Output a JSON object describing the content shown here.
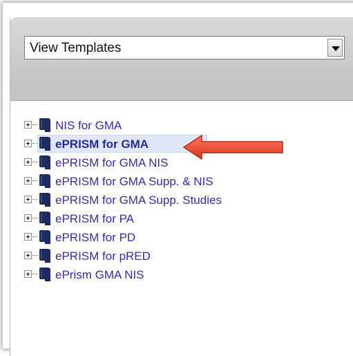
{
  "templates_select": {
    "value": "View Templates"
  },
  "tree": {
    "items": [
      {
        "label": "NIS for GMA"
      },
      {
        "label": "ePRISM for GMA"
      },
      {
        "label": "ePRISM for GMA NIS"
      },
      {
        "label": "ePRISM for GMA Supp. & NIS"
      },
      {
        "label": "ePRISM for GMA Supp. Studies"
      },
      {
        "label": "ePRISM for PA"
      },
      {
        "label": "ePRISM for PD"
      },
      {
        "label": "ePRISM for pRED"
      },
      {
        "label": "ePrism GMA NIS"
      }
    ],
    "selected_index": 1
  },
  "colors": {
    "link": "#3a2aa8",
    "icon": "#1d2a5e",
    "callout_arrow": "#e8462e",
    "header": "#c9c9c9"
  }
}
